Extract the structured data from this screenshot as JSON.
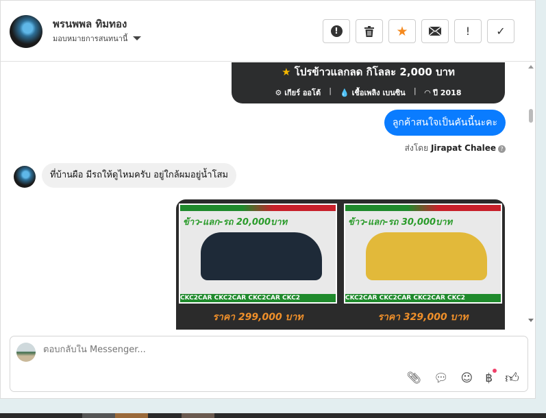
{
  "header": {
    "contact_name": "พรนพพล ทิมทอง",
    "assign_label": "มอบหมายการสนทนานี้"
  },
  "toolbar": [
    {
      "icon": "alert-circle-icon",
      "glyph": "❗"
    },
    {
      "icon": "trash-icon",
      "glyph": "🗑"
    },
    {
      "icon": "star-icon",
      "glyph": "★",
      "color": "#f58a1f"
    },
    {
      "icon": "envelope-icon",
      "glyph": "✉"
    },
    {
      "icon": "exclamation-icon",
      "glyph": "!"
    },
    {
      "icon": "check-icon",
      "glyph": "✓"
    }
  ],
  "messages": {
    "promo_card": {
      "title": "โปรข้าวแลกลด กิโลละ 2,000 บาท",
      "gear": "เกียร์ ออโต้",
      "fuel": "เชื้อเพลิง เบนซิน",
      "year": "ปี 2018"
    },
    "outgoing": "ลูกค้าสนใจเป็นคันนี้นะคะ",
    "sent_by_prefix": "ส่งโดย",
    "sent_by_name": "Jirapat Chalee",
    "incoming": "ที่บ้านผือ มีรถให้ดูไหมครับ อยู่ใกล้ผมอยู่น้ำโสม",
    "cars": [
      {
        "badge": "ข้าว-แลก-รถ 20,000บาท",
        "banner": "CKC2CAR CKC2CAR CKC2CAR CKC2",
        "price": "ราคา 299,000 บาท",
        "color": "#1e2a38"
      },
      {
        "badge": "ข้าว-แลก-รถ 30,000บาท",
        "banner": "CKC2CAR CKC2CAR CKC2CAR CKC2",
        "price": "ราคา 329,000 บาท",
        "color": "#e2b93a"
      }
    ]
  },
  "composer": {
    "placeholder": "ตอบกลับใน Messenger..."
  }
}
